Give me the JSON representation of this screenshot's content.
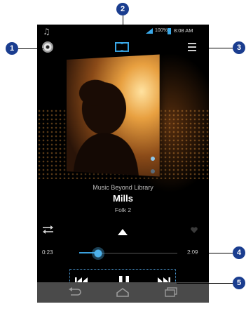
{
  "status_bar": {
    "battery_percent": "100%",
    "time": "8:08 AM"
  },
  "track": {
    "album": "Music Beyond Library",
    "title": "Mills",
    "artist": "Folk 2"
  },
  "progress": {
    "elapsed": "0:23",
    "total": "2:09",
    "fraction": 0.18
  },
  "icons": {
    "top_left": "disc-icon",
    "top_center": "dolby-icon",
    "top_right": "menu-icon",
    "shuffle": "shuffle-icon",
    "expand": "triangle-up-icon",
    "favorite": "heart-icon",
    "previous": "previous-track-icon",
    "pause": "pause-icon",
    "next": "next-track-icon",
    "back": "back-icon",
    "home": "home-icon",
    "recent": "recent-apps-icon"
  },
  "callouts": [
    "1",
    "2",
    "3",
    "4",
    "5"
  ],
  "colors": {
    "accent": "#3aa0dd",
    "callout": "#1a3d8f",
    "nav_bar": "#4a4a4a"
  }
}
